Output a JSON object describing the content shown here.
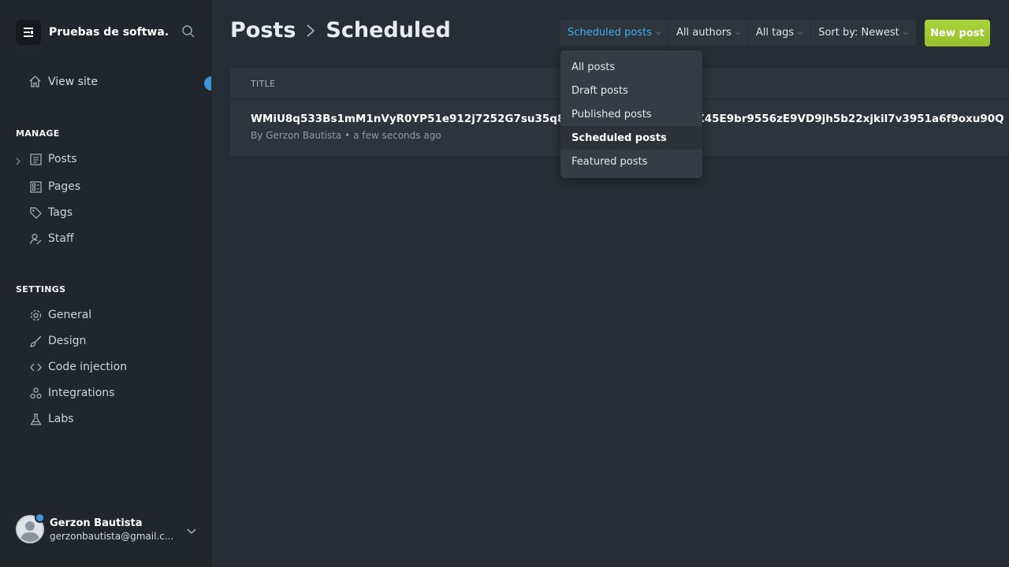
{
  "sidebar": {
    "site_title": "Pruebas de softwa...",
    "view_site": "View site",
    "manage_title": "MANAGE",
    "manage_items": [
      {
        "label": "Posts"
      },
      {
        "label": "Pages"
      },
      {
        "label": "Tags"
      },
      {
        "label": "Staff"
      }
    ],
    "settings_title": "SETTINGS",
    "settings_items": [
      {
        "label": "General"
      },
      {
        "label": "Design"
      },
      {
        "label": "Code injection"
      },
      {
        "label": "Integrations"
      },
      {
        "label": "Labs"
      }
    ],
    "user": {
      "name": "Gerzon Bautista",
      "email": "gerzonbautista@gmail.c..."
    }
  },
  "header": {
    "breadcrumb_root": "Posts",
    "breadcrumb_current": "Scheduled",
    "filters": {
      "type": "Scheduled posts",
      "authors": "All authors",
      "tags": "All tags",
      "sort": "Sort by: Newest"
    },
    "new_post": "New post"
  },
  "table": {
    "column_title": "TITLE",
    "rows": [
      {
        "title": "WMiU8q533Bs1mM1nVyR0YP51e912j7252G7su35q8zs",
        "title_tail": "x0X45E9br9556zE9VD9jh5b22xjkil7v3951a6f9oxu90Q",
        "meta": "By Gerzon Bautista • a few seconds ago"
      }
    ]
  },
  "dropdown": {
    "items": [
      {
        "label": "All posts"
      },
      {
        "label": "Draft posts"
      },
      {
        "label": "Published posts"
      },
      {
        "label": "Scheduled posts"
      },
      {
        "label": "Featured posts"
      }
    ],
    "selected": "Scheduled posts"
  },
  "colors": {
    "accent": "#3eb0ef",
    "primary_button": "#a4d037",
    "notification": "#3e96d8"
  }
}
